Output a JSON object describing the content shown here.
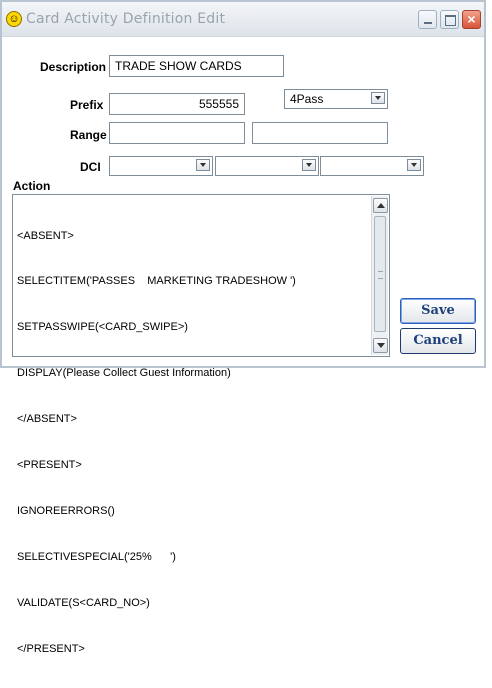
{
  "window": {
    "title": "Card Activity Definition Edit",
    "controls": {
      "minimize": "",
      "maximize": "",
      "close": "×"
    }
  },
  "form": {
    "description_label": "Description",
    "description_value": "TRADE SHOW CARDS",
    "prefix_label": "Prefix",
    "prefix_value": "555555",
    "prefix_type_selected": "4Pass",
    "range_label": "Range",
    "range_start": "",
    "range_end": "",
    "dci_label": "DCI",
    "dci_selects": [
      "",
      "",
      ""
    ],
    "action_label": "Action",
    "action_lines": [
      "<ABSENT>",
      "SELECTITEM('PASSES    MARKETING TRADESHOW ')",
      "SETPASSWIPE(<CARD_SWIPE>)",
      "DISPLAY(Please Collect Guest Information)",
      "</ABSENT>",
      "<PRESENT>",
      "IGNOREERRORS()",
      "SELECTIVESPECIAL('25%      ')",
      "VALIDATE(S<CARD_NO>)",
      "</PRESENT>"
    ]
  },
  "buttons": {
    "save": "Save",
    "cancel": "Cancel"
  },
  "colors": {
    "button_text": "#1e3f7a",
    "title_text": "#9aa4ae",
    "close_button": "#d9533a"
  },
  "icons": {
    "app": "smiley-icon"
  }
}
